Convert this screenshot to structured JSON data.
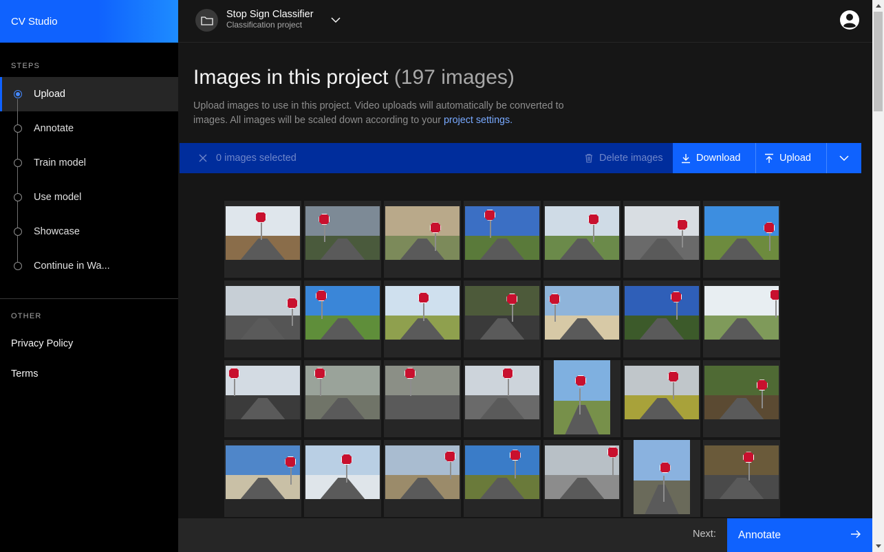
{
  "app": {
    "name": "CV Studio"
  },
  "sidebar": {
    "steps_label": "STEPS",
    "steps": [
      {
        "label": "Upload",
        "active": true
      },
      {
        "label": "Annotate",
        "active": false
      },
      {
        "label": "Train model",
        "active": false
      },
      {
        "label": "Use model",
        "active": false
      },
      {
        "label": "Showcase",
        "active": false
      },
      {
        "label": "Continue in Wa...",
        "active": false
      }
    ],
    "other_label": "OTHER",
    "links": [
      {
        "label": "Privacy Policy"
      },
      {
        "label": "Terms"
      }
    ]
  },
  "header": {
    "project_title": "Stop Sign Classifier",
    "project_subtitle": "Classification project",
    "project_icon": "folder-icon",
    "user_icon": "user-avatar-icon"
  },
  "main": {
    "title": "Images in this project",
    "title_count": "(197 images)",
    "description": "Upload images to use in this project. Video uploads will automatically be converted to images. All images will be scaled down according to your ",
    "description_link": "project settings."
  },
  "toolbar": {
    "selected_text": "0 images selected",
    "delete_label": "Delete images",
    "download_label": "Download",
    "upload_label": "Upload"
  },
  "grid": {
    "image_count_shown": 28,
    "thumbnails": [
      {
        "sky": "#dfe6ec",
        "ground": "#8a6d4a"
      },
      {
        "sky": "#7d8a96",
        "ground": "#4a5a3c"
      },
      {
        "sky": "#b9a98a",
        "ground": "#7c8a5a"
      },
      {
        "sky": "#3b6fc4",
        "ground": "#5a7a3a"
      },
      {
        "sky": "#cfdbe6",
        "ground": "#6b8a4a"
      },
      {
        "sky": "#d8dde2",
        "ground": "#6a6a6a"
      },
      {
        "sky": "#3d8ee0",
        "ground": "#6d8b3e"
      },
      {
        "sky": "#c7cfd6",
        "ground": "#555555"
      },
      {
        "sky": "#3a86d8",
        "ground": "#5f8e3a"
      },
      {
        "sky": "#cfe0ee",
        "ground": "#8fa04e"
      },
      {
        "sky": "#4d5a3a",
        "ground": "#3a3a3a"
      },
      {
        "sky": "#8fb4da",
        "ground": "#d7c9a6"
      },
      {
        "sky": "#2f5fb8",
        "ground": "#3c5a2a"
      },
      {
        "sky": "#e8eef2",
        "ground": "#7f9a5a"
      },
      {
        "sky": "#d3dbe3",
        "ground": "#3b3b3b"
      },
      {
        "sky": "#9aa39a",
        "ground": "#707468"
      },
      {
        "sky": "#8b8f86",
        "ground": "#5a5a5a"
      },
      {
        "sky": "#cdd4db",
        "ground": "#6a6a6a"
      },
      {
        "sky": "#7fb0e0",
        "ground": "#77904a"
      },
      {
        "sky": "#c0c6ca",
        "ground": "#a8a23a"
      },
      {
        "sky": "#4f6a34",
        "ground": "#5b4a32"
      },
      {
        "sky": "#4f86c9",
        "ground": "#c9c0a6"
      },
      {
        "sky": "#b9cfe4",
        "ground": "#dfe5ea"
      },
      {
        "sky": "#a9bcd0",
        "ground": "#9b8b6a"
      },
      {
        "sky": "#3a7cc8",
        "ground": "#6a7a3a"
      },
      {
        "sky": "#b8c0c6",
        "ground": "#8c8c8c"
      },
      {
        "sky": "#8ab2df",
        "ground": "#6a6a5a"
      },
      {
        "sky": "#6a5a3a",
        "ground": "#4a4a4a"
      }
    ]
  },
  "footer": {
    "next_label": "Next:",
    "next_button": "Annotate"
  }
}
